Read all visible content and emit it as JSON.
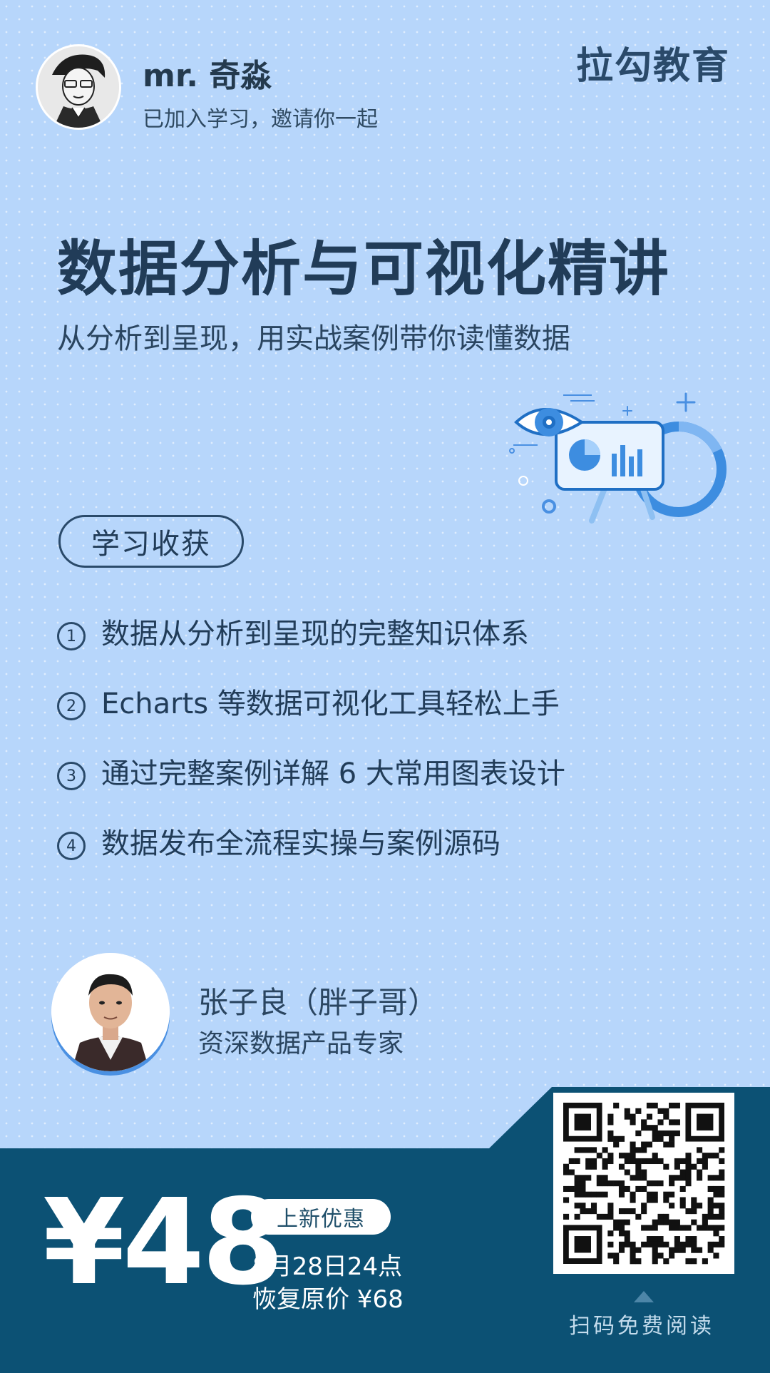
{
  "header": {
    "user_name": "mr. 奇淼",
    "user_invite": "已加入学习，邀请你一起",
    "brand": "拉勾教育"
  },
  "course": {
    "title": "数据分析与可视化精讲",
    "subtitle": "从分析到呈现，用实战案例带你读懂数据"
  },
  "benefits": {
    "section_label": "学习收获",
    "items": [
      {
        "num": "1",
        "text": "数据从分析到呈现的完整知识体系"
      },
      {
        "num": "2",
        "text": "Echarts 等数据可视化工具轻松上手"
      },
      {
        "num": "3",
        "text": "通过完整案例详解 6 大常用图表设计"
      },
      {
        "num": "4",
        "text": "数据发布全流程实操与案例源码"
      }
    ]
  },
  "teacher": {
    "name": "张子良（胖子哥）",
    "title": "资深数据产品专家"
  },
  "offer": {
    "price": "¥48",
    "badge": "上新优惠",
    "date_line": "8月28日24点",
    "original_line": "恢复原价 ¥68",
    "scan_label": "扫码免费阅读"
  },
  "icons": {
    "user_avatar": "user-avatar-icon",
    "illustration": "data-visualization-eye-illustration",
    "qr": "qr-code-icon"
  },
  "colors": {
    "background": "#b7d6fb",
    "band": "#0c5174",
    "title": "#213c58",
    "accent": "#4a90e2"
  }
}
